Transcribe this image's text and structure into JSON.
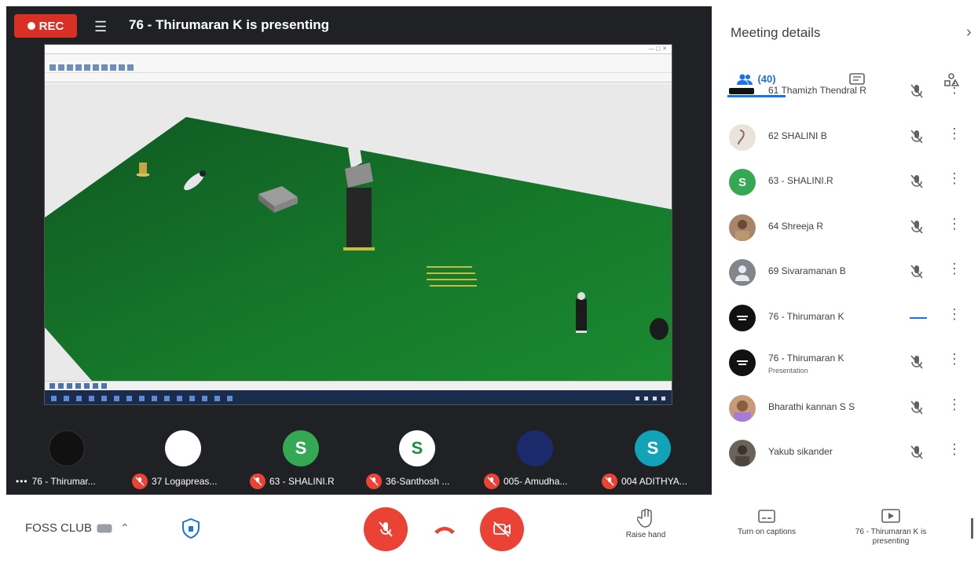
{
  "stage": {
    "rec_label": "REC",
    "presenter_title": "76 - Thirumaran K is presenting",
    "shared_window": {
      "title_text": "",
      "menu_text": "",
      "toolbar_text": ""
    }
  },
  "tiles": [
    {
      "name": "76 - Thirumar...",
      "avatar_letter": "",
      "avatar_color": "#111111",
      "muted": false,
      "has_more": true
    },
    {
      "name": "37 Logapreas...",
      "avatar_letter": "",
      "avatar_color": "#ffffff",
      "muted": true
    },
    {
      "name": "63 - SHALINI.R",
      "avatar_letter": "S",
      "avatar_color": "#34a853",
      "muted": true
    },
    {
      "name": "36-Santhosh ...",
      "avatar_letter": "S",
      "avatar_color": "#ffffff",
      "muted": true
    },
    {
      "name": "005- Amudha...",
      "avatar_letter": "",
      "avatar_color": "#1b2a6b",
      "muted": true
    },
    {
      "name": "004 ADITHYA...",
      "avatar_letter": "S",
      "avatar_color": "#12a3b8",
      "muted": true
    }
  ],
  "panel": {
    "title": "Meeting details",
    "close_icon": "chevron-right-icon",
    "tabs": {
      "people_count": "(40)",
      "chat_icon": "chat-icon",
      "activities_icon": "activities-icon"
    },
    "participants": [
      {
        "name": "61 Thamizh Thendral R",
        "sub": "",
        "avatar_letter": "",
        "avatar_color": "#111111",
        "mic": "muted"
      },
      {
        "name": "62 SHALINI B",
        "sub": "",
        "avatar_letter": "",
        "avatar_color": "#e9e3dc",
        "mic": "muted"
      },
      {
        "name": "63 - SHALINI.R",
        "sub": "",
        "avatar_letter": "S",
        "avatar_color": "#34a853",
        "mic": "muted"
      },
      {
        "name": "64 Shreeja R",
        "sub": "",
        "avatar_letter": "",
        "avatar_color": "#a8846a",
        "mic": "muted"
      },
      {
        "name": "69 Sivaramanan B",
        "sub": "",
        "avatar_letter": "",
        "avatar_color": "#80868b",
        "mic": "muted"
      },
      {
        "name": "76 - Thirumaran K",
        "sub": "",
        "avatar_letter": "",
        "avatar_color": "#111111",
        "mic": "speaking"
      },
      {
        "name": "76 - Thirumaran K",
        "sub": "Presentation",
        "avatar_letter": "",
        "avatar_color": "#111111",
        "mic": "muted"
      },
      {
        "name": "Bharathi kannan S S",
        "sub": "",
        "avatar_letter": "",
        "avatar_color": "#c69a7a",
        "mic": "muted"
      },
      {
        "name": "Yakub sikander",
        "sub": "",
        "avatar_letter": "",
        "avatar_color": "#6b625a",
        "mic": "muted"
      }
    ]
  },
  "bottombar": {
    "meeting_name": "FOSS CLUB",
    "raise_hand_label": "Raise hand",
    "captions_label": "Turn on captions",
    "presenting_label": "76 - Thirumaran K is presenting"
  }
}
